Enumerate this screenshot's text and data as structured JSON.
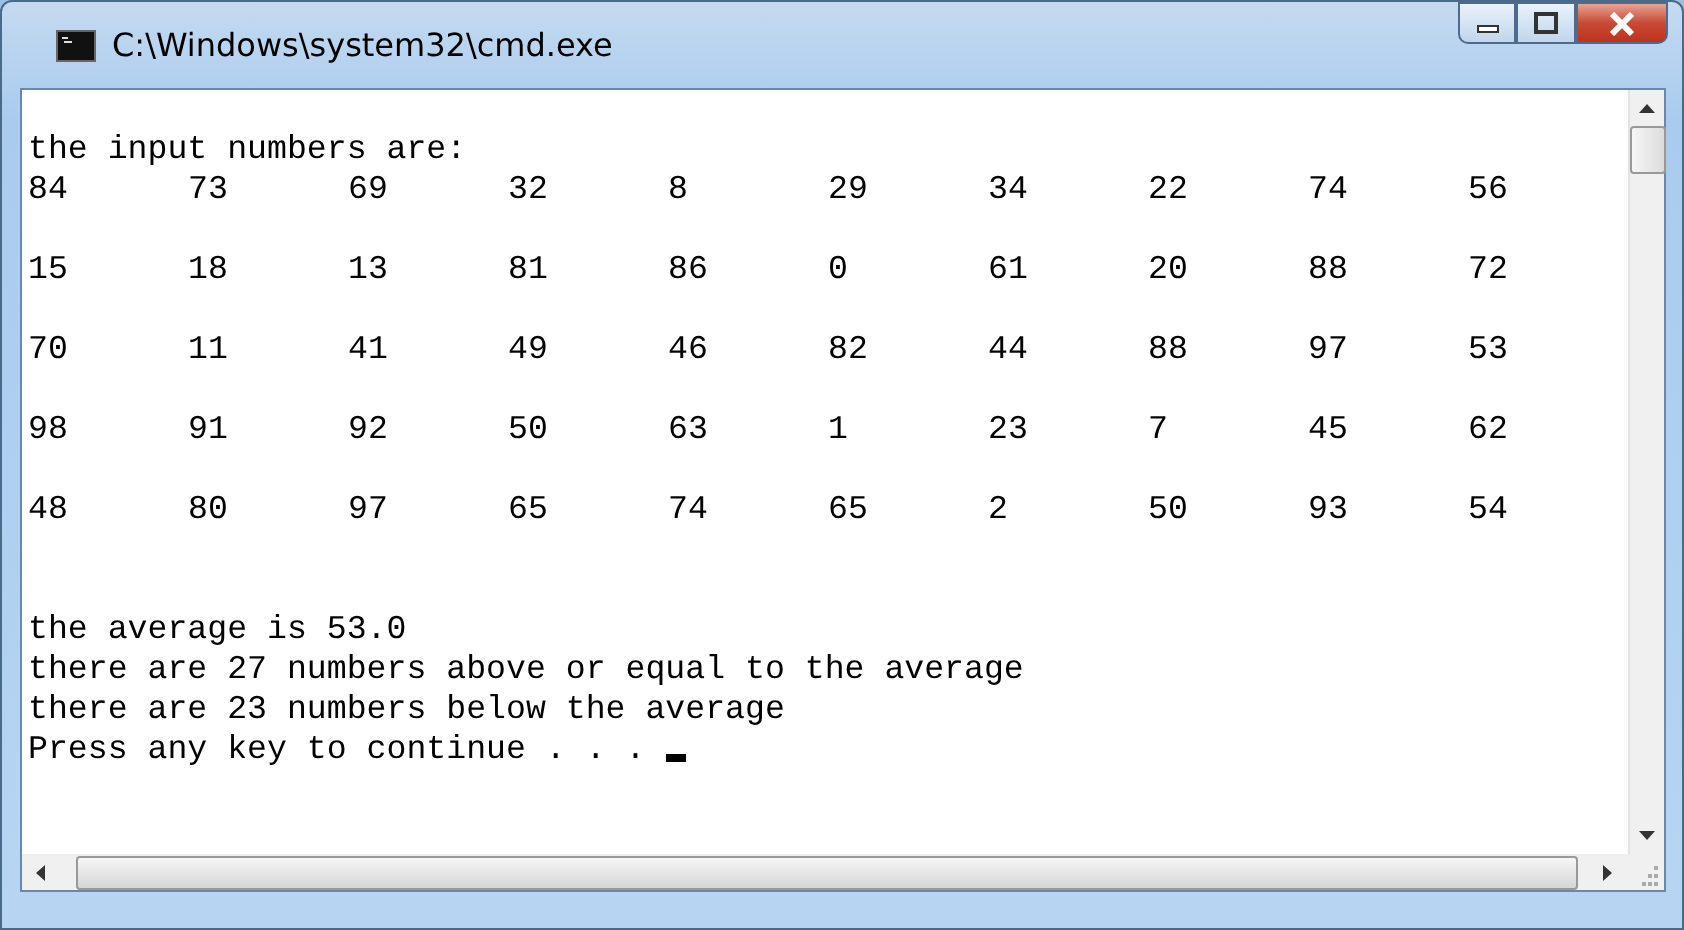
{
  "window": {
    "title": "C:\\Windows\\system32\\cmd.exe"
  },
  "console": {
    "heading": "the input numbers are:",
    "number_rows": [
      [
        "84",
        "73",
        "69",
        "32",
        "8",
        "29",
        "34",
        "22",
        "74",
        "56"
      ],
      [
        "15",
        "18",
        "13",
        "81",
        "86",
        "0",
        "61",
        "20",
        "88",
        "72"
      ],
      [
        "70",
        "11",
        "41",
        "49",
        "46",
        "82",
        "44",
        "88",
        "97",
        "53"
      ],
      [
        "98",
        "91",
        "92",
        "50",
        "63",
        "1",
        "23",
        "7",
        "45",
        "62"
      ],
      [
        "48",
        "80",
        "97",
        "65",
        "74",
        "65",
        "2",
        "50",
        "93",
        "54"
      ]
    ],
    "summary": [
      "the average is 53.0",
      "there are 27 numbers above or equal to the average",
      "there are 23 numbers below the average"
    ],
    "prompt": "Press any key to continue . . ."
  }
}
